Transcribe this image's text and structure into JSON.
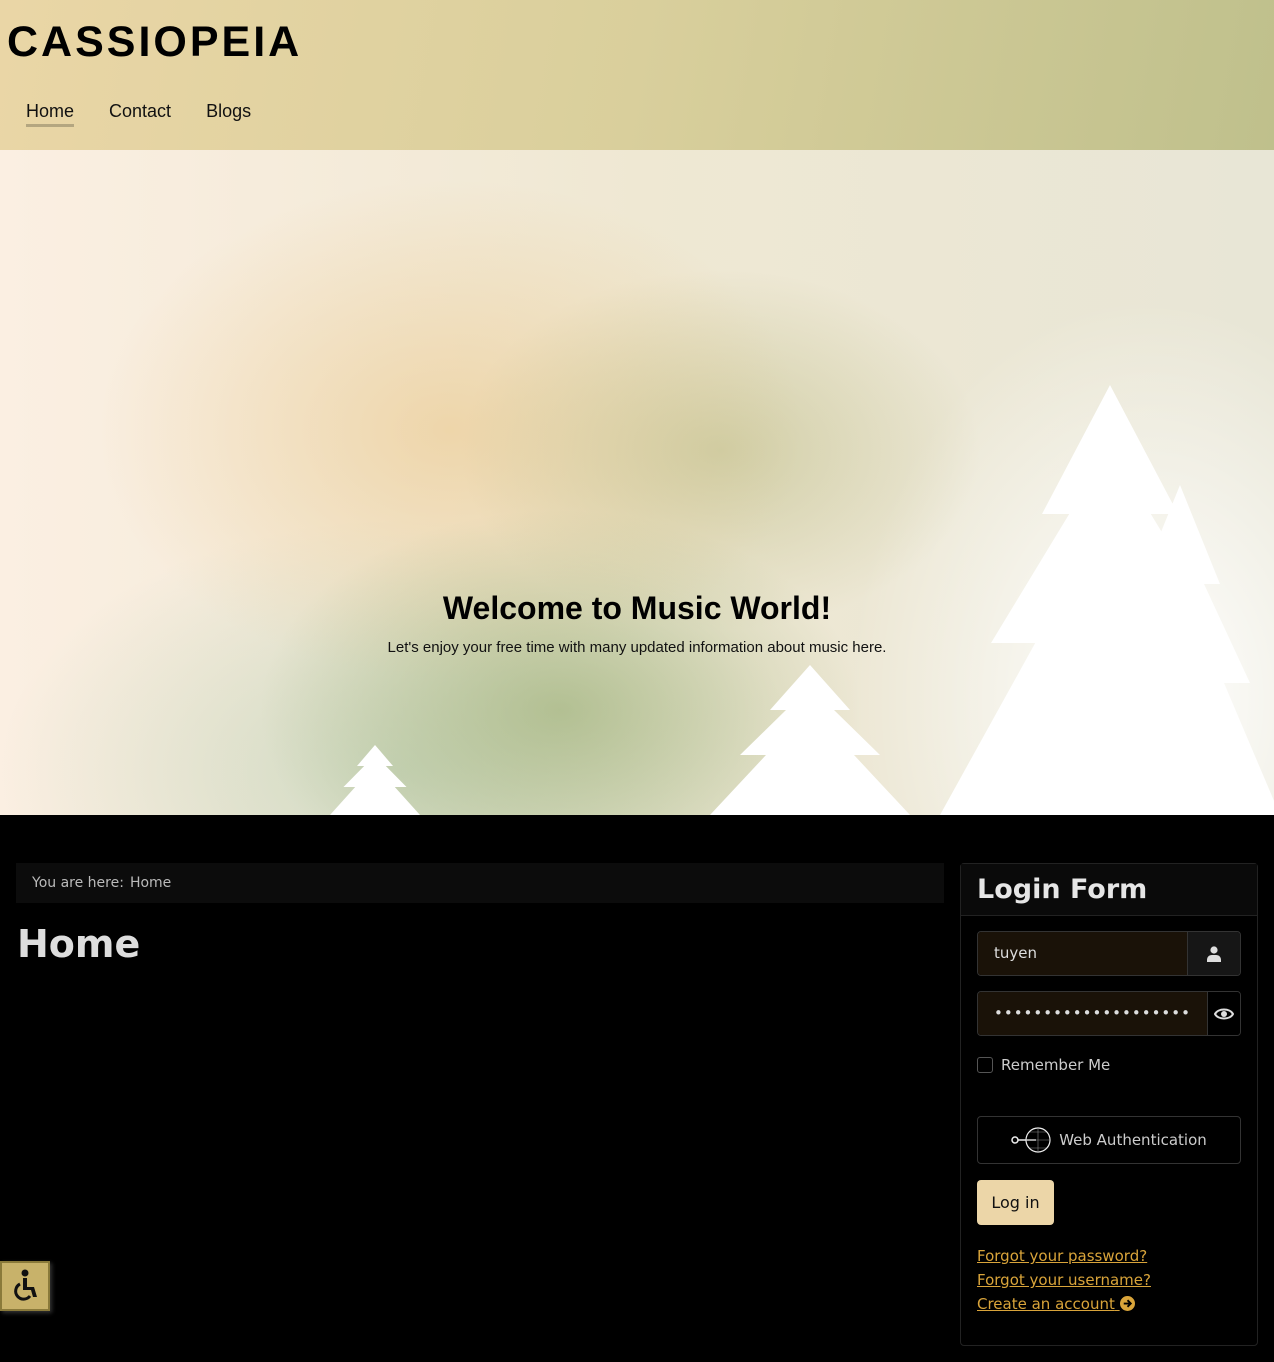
{
  "site": {
    "brand": "CASSIOPEIA",
    "nav": [
      {
        "label": "Home",
        "active": true
      },
      {
        "label": "Contact"
      },
      {
        "label": "Blogs"
      }
    ]
  },
  "hero": {
    "title": "Welcome to Music World!",
    "subtitle": "Let's enjoy your free time with many updated information about music here."
  },
  "breadcrumb": {
    "prefix": "You are here:",
    "current": "Home"
  },
  "page": {
    "title": "Home"
  },
  "login": {
    "title": "Login Form",
    "username": "tuyen",
    "password": "••••••••••••••••••••",
    "remember": "Remember Me",
    "webauth": "Web Authentication",
    "submit": "Log in",
    "links": [
      "Forgot your password?",
      "Forgot your username?",
      "Create an account"
    ],
    "icons": {
      "user": "user-icon",
      "password": "eye-icon",
      "create": "arrow-circle-right-icon"
    }
  },
  "colors": {
    "link": "#d9a43a",
    "button": "#ecd6a8"
  }
}
